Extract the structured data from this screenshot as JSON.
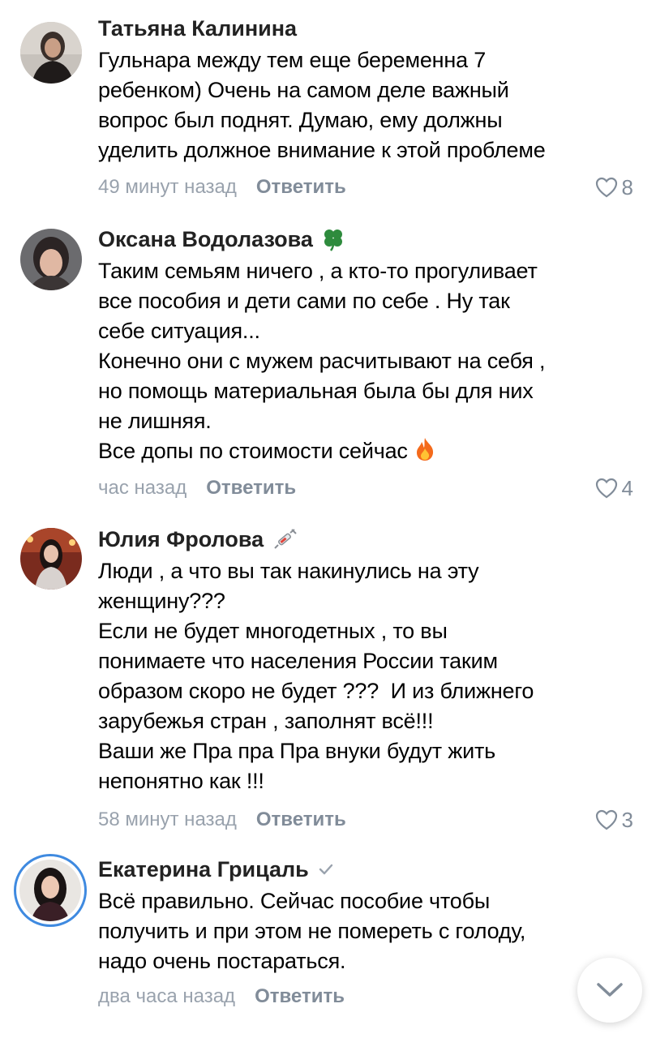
{
  "comments": [
    {
      "author": "Татьяна Калинина",
      "text": "Гульнара между тем еще беременна 7\nребенком) Очень на самом деле важный\nвопрос был поднят. Думаю, ему должны\nуделить должное внимание к этой проблеме",
      "time": "49 минут назад",
      "reply_label": "Ответить",
      "likes": "8"
    },
    {
      "author": "Оксана Водолазова",
      "badge": "clover-icon",
      "text": "Таким семьям ничего , а кто-то прогуливает\nвсе пособия и дети сами по себе . Ну так\nсебе ситуация...\nКонечно они с мужем расчитывают на себя ,\nно помощь материальная была бы для них\nне лишняя.\nВсе допы по стоимости сейчас",
      "text_emoji": "fire-icon",
      "time": "час назад",
      "reply_label": "Ответить",
      "likes": "4"
    },
    {
      "author": "Юлия Фролова",
      "badge": "syringe-icon",
      "text": "Люди , а что вы так накинулись на эту\nженщину???\nЕсли не будет многодетных , то вы\nпонимаете что населения России таким\nобразом скоро не будет ???  И из ближнего\nзарубежья стран , заполнят всё!!!\nВаши же Пра пра Пра внуки будут жить\nнепонятно как !!!",
      "time": "58 минут назад",
      "reply_label": "Ответить",
      "likes": "3"
    },
    {
      "author": "Екатерина Грицаль",
      "badge": "verified-check-icon",
      "text": "Всё правильно. Сейчас пособие чтобы\nполучить и при этом не помереть с голоду,\nнадо очень постараться.",
      "time": "два часа назад",
      "reply_label": "Ответить"
    }
  ],
  "colors": {
    "meta": "#99a2ad",
    "reply": "#818c99",
    "story_ring": "#3f8ae0"
  },
  "scroll_button_icon": "chevron-down-icon"
}
